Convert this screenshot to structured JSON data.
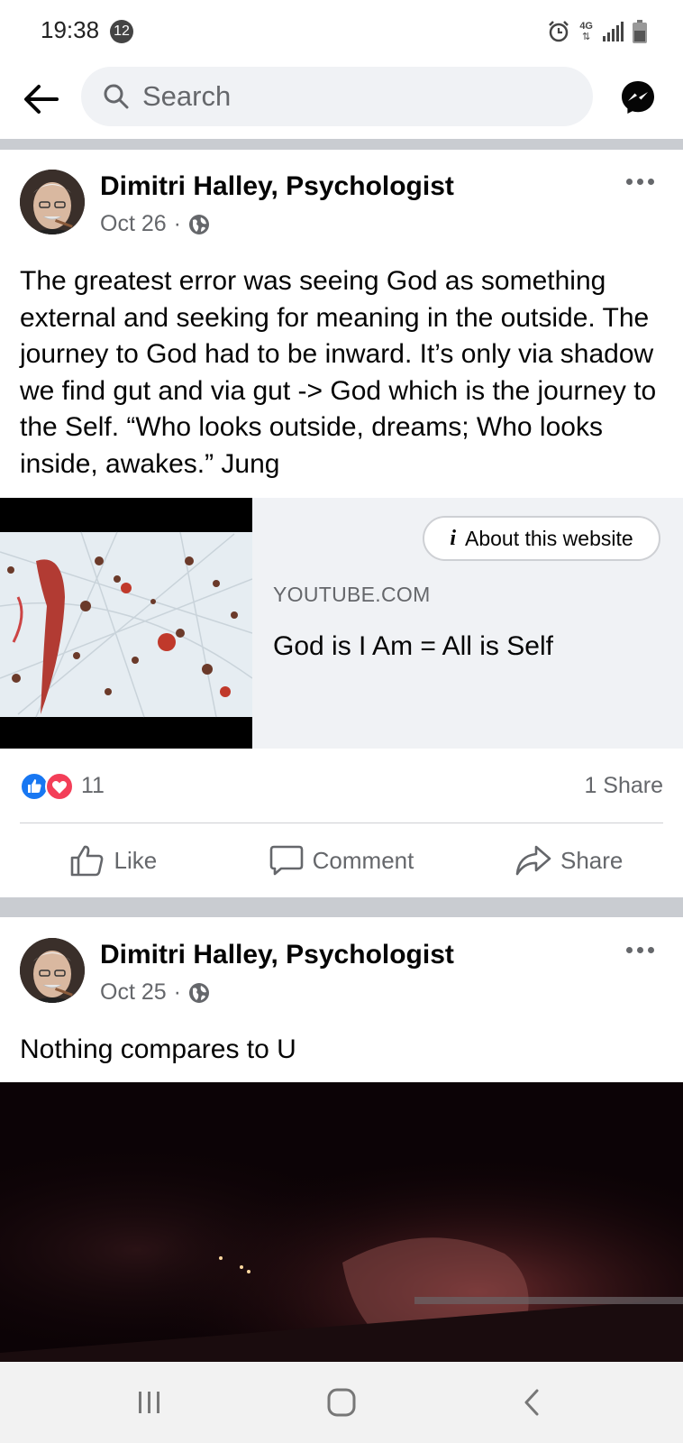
{
  "status_bar": {
    "time": "19:38",
    "notification_count": "12",
    "network_label": "4G",
    "icons": [
      "alarm-icon",
      "network-4g-icon",
      "signal-icon",
      "battery-icon"
    ]
  },
  "top_nav": {
    "back_icon": "arrow-left-icon",
    "search_placeholder": "Search",
    "messenger_icon": "messenger-icon"
  },
  "posts": [
    {
      "author": "Dimitri Halley, Psychologist",
      "date": "Oct 26",
      "separator": "·",
      "audience_icon": "globe-icon",
      "text": "The greatest error was seeing God as something external and seeking for meaning in the outside. The journey to God had to be inward. It’s only via shadow we find gut and via gut -> God which is the journey to the Self. “Who looks outside, dreams; Who looks inside, awakes.” Jung",
      "link_preview": {
        "about_label": "About this website",
        "domain": "YOUTUBE.COM",
        "title": "God is I Am = All is Self"
      },
      "reactions": {
        "types": [
          "like",
          "love"
        ],
        "count": "11",
        "shares": "1 Share"
      },
      "actions": {
        "like": "Like",
        "comment": "Comment",
        "share": "Share"
      }
    },
    {
      "author": "Dimitri Halley, Psychologist",
      "date": "Oct 25",
      "separator": "·",
      "audience_icon": "globe-icon",
      "text": "Nothing compares to U"
    }
  ],
  "colors": {
    "facebook_blue": "#1877f2",
    "love_red": "#f33e58",
    "secondary_text": "#65676b",
    "divider": "#c9ccd1"
  }
}
